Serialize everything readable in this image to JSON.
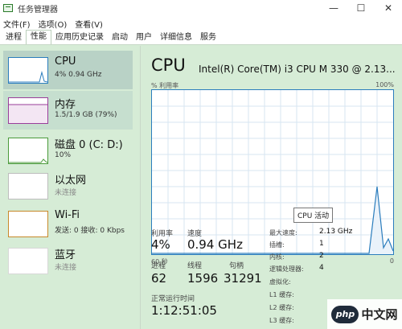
{
  "window": {
    "title": "任务管理器",
    "minimize": "—",
    "maximize": "☐",
    "close": "✕"
  },
  "menu": [
    "文件(F)",
    "选项(O)",
    "查看(V)"
  ],
  "tabs": [
    "进程",
    "性能",
    "应用历史记录",
    "启动",
    "用户",
    "详细信息",
    "服务"
  ],
  "active_tab": "性能",
  "sidebar": [
    {
      "name": "CPU",
      "sub": "4% 0.94 GHz",
      "state": "selected"
    },
    {
      "name": "内存",
      "sub": "1.5/1.9 GB (79%)",
      "state": "hover"
    },
    {
      "name": "磁盘 0 (C: D:)",
      "sub": "10%",
      "state": ""
    },
    {
      "name": "以太网",
      "sub": "未连接",
      "state": ""
    },
    {
      "name": "Wi-Fi",
      "sub": "发送: 0 接收: 0 Kbps",
      "state": ""
    },
    {
      "name": "蓝牙",
      "sub": "未连接",
      "state": ""
    }
  ],
  "main": {
    "title": "CPU",
    "model": "Intel(R) Core(TM) i3 CPU M 330 @ 2.13...",
    "util_label": "% 利用率",
    "util_max": "100%",
    "axis_left": "60 秒",
    "axis_right": "0",
    "tooltip": "CPU 活动",
    "stats": {
      "utilization_label": "利用率",
      "utilization": "4%",
      "speed_label": "速度",
      "speed": "0.94 GHz",
      "processes_label": "进程",
      "processes": "62",
      "threads_label": "线程",
      "threads": "1596",
      "handles_label": "句柄",
      "handles": "31291",
      "uptime_label": "正常运行时间",
      "uptime": "1:12:51:05"
    },
    "details": [
      {
        "label": "最大速度:",
        "value": "2.13 GHz"
      },
      {
        "label": "插槽:",
        "value": "1"
      },
      {
        "label": "内核:",
        "value": "2"
      },
      {
        "label": "逻辑处理器:",
        "value": "4"
      },
      {
        "label": "虚拟化:",
        "value": ""
      },
      {
        "label": "L1 缓存:",
        "value": ""
      },
      {
        "label": "L2 缓存:",
        "value": ""
      },
      {
        "label": "L3 缓存:",
        "value": ""
      }
    ]
  },
  "watermark": {
    "logo": "php",
    "text": "中文网"
  },
  "colors": {
    "cpu": "#2b7dbd",
    "memory": "#9a3d9a",
    "disk": "#4a9a3a",
    "wifi": "#c8882a"
  }
}
